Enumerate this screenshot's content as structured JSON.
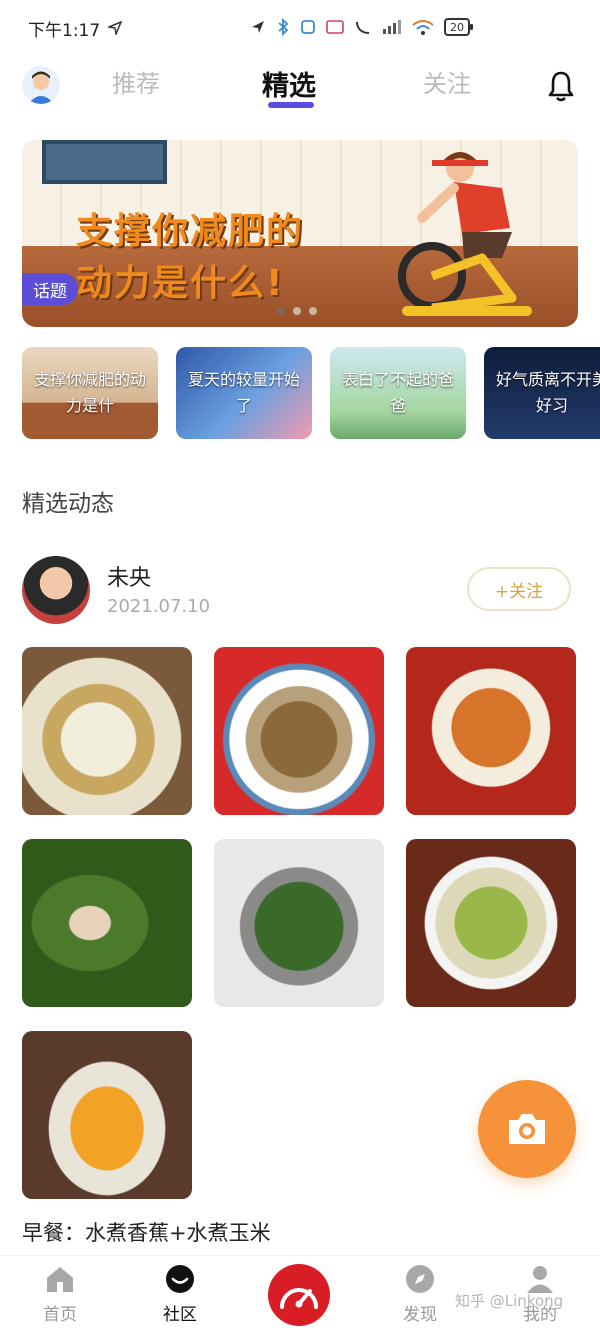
{
  "status_bar": {
    "time": "下午1:17",
    "battery": "20"
  },
  "header": {
    "tabs": [
      {
        "label": "推荐",
        "active": false
      },
      {
        "label": "精选",
        "active": true
      },
      {
        "label": "关注",
        "active": false
      }
    ]
  },
  "banner": {
    "title_line1": "支撑你减肥的",
    "title_line2": "动力是什么!",
    "badge": "话题",
    "page_count": 3,
    "current_page": 1
  },
  "topics": [
    {
      "label": "支撑你减肥的动力是什"
    },
    {
      "label": "夏天的较量开始了"
    },
    {
      "label": "表白了不起的爸爸"
    },
    {
      "label": "好气质离不开美好习"
    }
  ],
  "section": {
    "title": "精选动态"
  },
  "post": {
    "user_name": "未央",
    "date": "2021.07.10",
    "follow_label": "+关注",
    "caption": "早餐：水煮香蕉+水煮玉米",
    "photo_count": 7
  },
  "bottom_nav": {
    "items": [
      {
        "label": "首页",
        "icon": "home-icon",
        "active": false
      },
      {
        "label": "社区",
        "icon": "community-icon",
        "active": true
      },
      {
        "label": "",
        "icon": "speedometer-icon",
        "active": false
      },
      {
        "label": "发现",
        "icon": "compass-icon",
        "active": false
      },
      {
        "label": "我的",
        "icon": "profile-icon",
        "active": false
      }
    ]
  },
  "watermark": "知乎 @Linkong",
  "colors": {
    "accent": "#5a4de6",
    "fab": "#f5923a",
    "center_button": "#d81e24",
    "follow_text": "#d9a440"
  }
}
